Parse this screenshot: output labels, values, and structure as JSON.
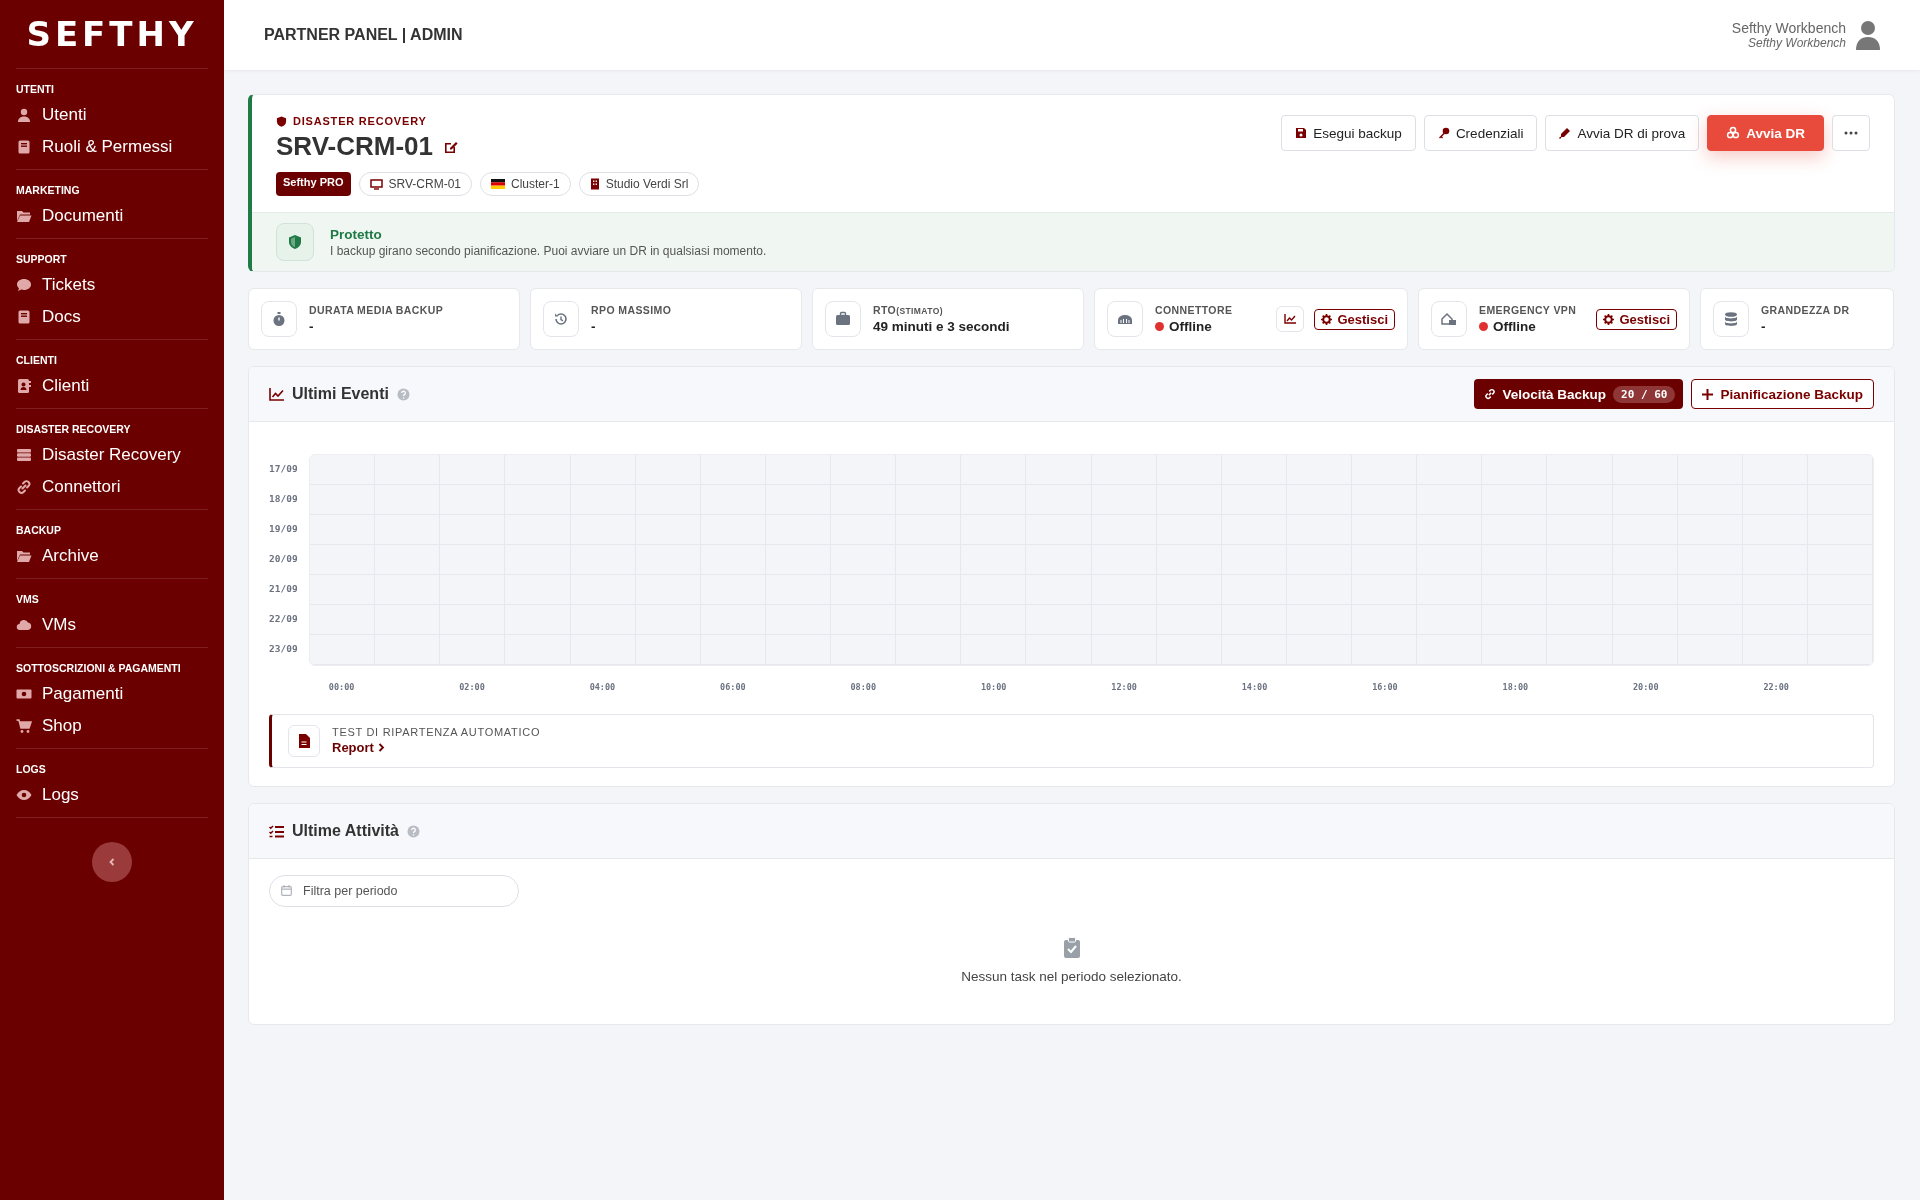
{
  "sidebar": {
    "logo": "SEFTHY",
    "sections": [
      {
        "title": "UTENTI",
        "items": [
          {
            "label": "Utenti"
          },
          {
            "label": "Ruoli & Permessi"
          }
        ]
      },
      {
        "title": "MARKETING",
        "items": [
          {
            "label": "Documenti"
          }
        ]
      },
      {
        "title": "SUPPORT",
        "items": [
          {
            "label": "Tickets"
          },
          {
            "label": "Docs"
          }
        ]
      },
      {
        "title": "CLIENTI",
        "items": [
          {
            "label": "Clienti"
          }
        ]
      },
      {
        "title": "DISASTER RECOVERY",
        "items": [
          {
            "label": "Disaster Recovery"
          },
          {
            "label": "Connettori"
          }
        ]
      },
      {
        "title": "BACKUP",
        "items": [
          {
            "label": "Archive"
          }
        ]
      },
      {
        "title": "VMS",
        "items": [
          {
            "label": "VMs"
          }
        ]
      },
      {
        "title": "SOTTOSCRIZIONI & PAGAMENTI",
        "items": [
          {
            "label": "Pagamenti"
          },
          {
            "label": "Shop"
          }
        ]
      },
      {
        "title": "LOGS",
        "items": [
          {
            "label": "Logs"
          }
        ]
      }
    ]
  },
  "topbar": {
    "title": "PARTNER PANEL | ADMIN",
    "user_name": "Sefthy Workbench",
    "user_subtitle": "Sefthy Workbench"
  },
  "server": {
    "section": "DISASTER RECOVERY",
    "name": "SRV-CRM-01",
    "tags": [
      {
        "kind": "badge",
        "label": "Sefthy PRO"
      },
      {
        "kind": "host",
        "label": "SRV-CRM-01"
      },
      {
        "kind": "cluster",
        "label": "Cluster-1"
      },
      {
        "kind": "company",
        "label": "Studio Verdi Srl"
      }
    ],
    "actions": [
      {
        "kind": "save",
        "label": "Esegui backup"
      },
      {
        "kind": "key",
        "label": "Credenziali"
      },
      {
        "kind": "test",
        "label": "Avvia DR di prova"
      },
      {
        "kind": "danger",
        "label": "Avvia DR"
      },
      {
        "kind": "more"
      }
    ],
    "status": {
      "title": "Protetto",
      "message": "I backup girano secondo pianificazione. Puoi avviare un DR in qualsiasi momento."
    }
  },
  "stats": [
    {
      "kind": "plain",
      "label": "DURATA MEDIA BACKUP",
      "value": "-"
    },
    {
      "kind": "plain",
      "label": "RPO MASSIMO",
      "value": "-"
    },
    {
      "kind": "plain",
      "label": "RTO",
      "note": "(STIMATO)",
      "value": "49 minuti e 3 secondi"
    },
    {
      "kind": "status",
      "label": "CONNETTORE",
      "value": "Offline",
      "color": "#e03131",
      "chart_button": true,
      "button": "Gestisci"
    },
    {
      "kind": "status",
      "label": "EMERGENCY VPN",
      "value": "Offline",
      "color": "#e03131",
      "chart_button": false,
      "button": "Gestisci"
    },
    {
      "kind": "plain",
      "label": "GRANDEZZA DR",
      "value": "-"
    }
  ],
  "events": {
    "title": "Ultimi Eventi",
    "speed_button": "Velocità Backup",
    "speed_count": "20 / 60",
    "schedule_button": "Pianificazione Backup",
    "y_labels": [
      "17/09",
      "18/09",
      "19/09",
      "20/09",
      "21/09",
      "22/09",
      "23/09"
    ],
    "x_labels": [
      "00:00",
      "02:00",
      "04:00",
      "06:00",
      "08:00",
      "10:00",
      "12:00",
      "14:00",
      "16:00",
      "18:00",
      "20:00",
      "22:00"
    ],
    "test": {
      "label": "TEST DI RIPARTENZA AUTOMATICO",
      "link": "Report"
    }
  },
  "activities": {
    "title": "Ultime Attività",
    "filter_placeholder": "Filtra per periodo",
    "empty": "Nessun task nel periodo selezionato."
  }
}
